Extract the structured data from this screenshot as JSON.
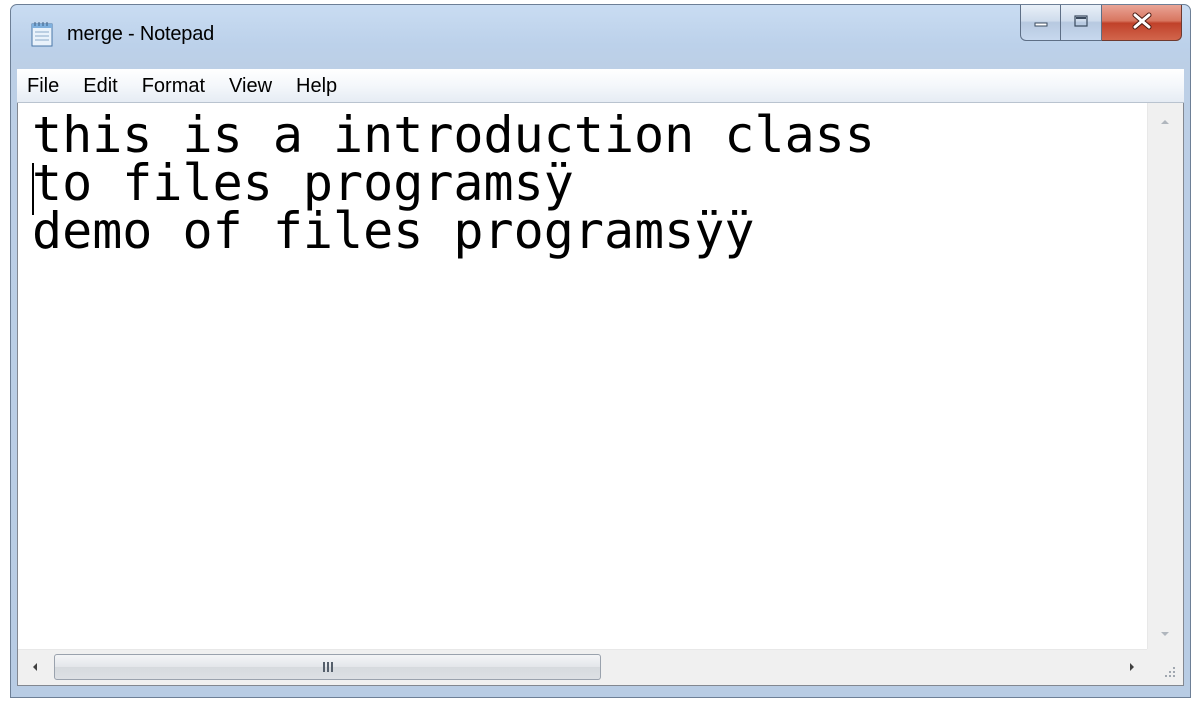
{
  "window": {
    "title": "merge - Notepad",
    "app_icon": "notepad-icon"
  },
  "caption_buttons": {
    "minimize": "minimize-icon",
    "maximize": "maximize-icon",
    "close_label": "X"
  },
  "menu": {
    "items": [
      {
        "label": "File"
      },
      {
        "label": "Edit"
      },
      {
        "label": "Format"
      },
      {
        "label": "View"
      },
      {
        "label": "Help"
      }
    ]
  },
  "document": {
    "lines": [
      "this is a introduction class",
      "to files programsÿ",
      "demo of files programsÿÿ"
    ]
  },
  "scrollbars": {
    "horizontal_grip": "III",
    "icons": [
      "scroll-up-arrow-icon",
      "scroll-down-arrow-icon",
      "scroll-left-arrow-icon",
      "scroll-right-arrow-icon",
      "size-grip-icon"
    ]
  },
  "colors": {
    "title_bar": "#bcd1ea",
    "close_button": "#c74d35",
    "editor_bg": "#ffffff"
  }
}
